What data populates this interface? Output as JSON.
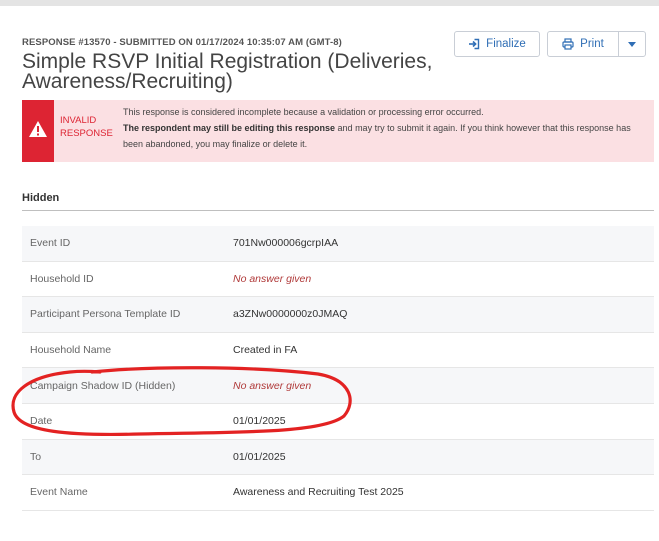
{
  "response": {
    "meta": "RESPONSE #13570 - SUBMITTED ON 01/17/2024 10:35:07 AM (GMT-8)",
    "title": "Simple RSVP Initial Registration (Deliveries, Awareness/Recruiting)"
  },
  "toolbar": {
    "finalize_label": "Finalize",
    "finalize_icon": "sign-in-icon",
    "print_label": "Print",
    "print_icon": "printer-icon",
    "accent_color": "#2f6eb5"
  },
  "alert": {
    "icon": "warning-triangle-icon",
    "label": "INVALID RESPONSE",
    "line1": "This response is considered incomplete because a validation or processing error occurred.",
    "line2_bold": "The respondent may still be editing this response",
    "line2_rest": " and may try to submit it again. If you think however that this response has been abandoned, you may finalize or delete it.",
    "color": "#dd2433",
    "background": "#fbe0e3"
  },
  "section": {
    "title": "Hidden"
  },
  "fields": [
    {
      "label": "Event ID",
      "value": "701Nw000006gcrpIAA",
      "empty": false
    },
    {
      "label": "Household ID",
      "value": "No answer given",
      "empty": true
    },
    {
      "label": "Participant Persona Template ID",
      "value": "a3ZNw0000000z0JMAQ",
      "empty": false
    },
    {
      "label": "Household Name",
      "value": "Created in FA",
      "empty": false
    },
    {
      "label": "Campaign Shadow ID (Hidden)",
      "value": "No answer given",
      "empty": true
    },
    {
      "label": "Date",
      "value": "01/01/2025",
      "empty": false
    },
    {
      "label": "To",
      "value": "01/01/2025",
      "empty": false
    },
    {
      "label": "Event Name",
      "value": "Awareness and Recruiting Test 2025",
      "empty": false
    }
  ],
  "annotation": {
    "color": "#e32222",
    "target": "Campaign Shadow ID (Hidden)"
  }
}
